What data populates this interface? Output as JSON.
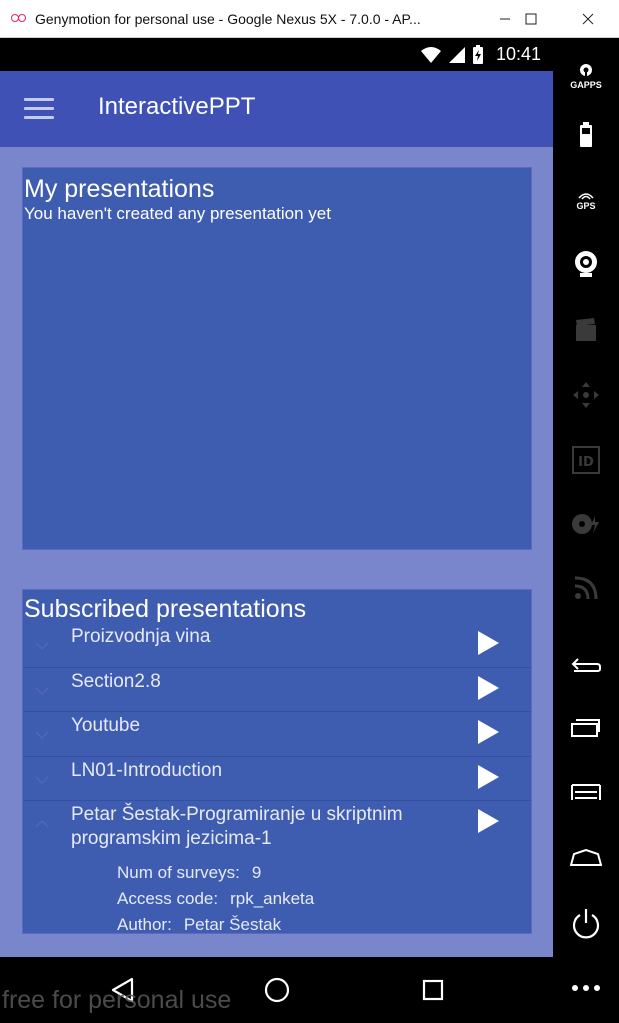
{
  "window": {
    "title": "Genymotion for personal use - Google Nexus 5X - 7.0.0 - AP...",
    "controls": [
      "minimize",
      "maximize",
      "close"
    ]
  },
  "statusbar": {
    "time": "10:41"
  },
  "appbar": {
    "title": "InteractivePPT"
  },
  "my_presentations": {
    "title": "My presentations",
    "empty_text": "You haven't created any presentation yet"
  },
  "subscribed": {
    "title": "Subscribed presentations",
    "items": [
      {
        "name": "Proizvodnja vina",
        "expanded": false
      },
      {
        "name": "Section2.8",
        "expanded": false
      },
      {
        "name": "Youtube",
        "expanded": false
      },
      {
        "name": "LN01-Introduction",
        "expanded": false
      },
      {
        "name": "Petar Šestak-Programiranje u skriptnim programskim jezicima-1",
        "expanded": true,
        "num_surveys_label": "Num of surveys:",
        "num_surveys": "9",
        "access_code_label": "Access code:",
        "access_code": "rpk_anketa",
        "author_label": "Author:",
        "author": "Petar Šestak"
      }
    ]
  },
  "watermark": "free for personal use",
  "sidebar": {
    "gapps_label": "GAPPS",
    "gps_label": "GPS",
    "icons": [
      "gapps-icon",
      "battery-icon",
      "gps-icon",
      "webcam-icon",
      "screencast-icon",
      "dpad-icon",
      "device-id-icon",
      "disk-icon",
      "rss-icon",
      "back-icon",
      "recent-apps-icon",
      "menu-icon",
      "home-icon",
      "power-icon",
      "more-icon"
    ]
  },
  "colors": {
    "accent": "#3f51b5",
    "background": "#7986cb",
    "card": "#3f5db0"
  }
}
